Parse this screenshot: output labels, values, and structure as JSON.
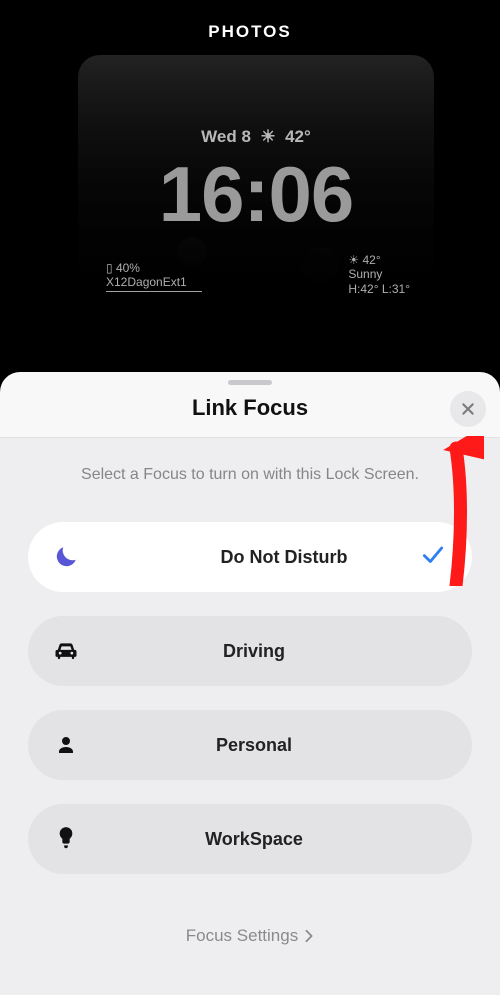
{
  "gallery": {
    "title": "PHOTOS"
  },
  "lockscreen": {
    "date": "Wed 8",
    "weather_glyph": "☀︎",
    "temp": "42°",
    "time": "16:06",
    "battery_pct": "40%",
    "wifi_name": "X12DagonExt1",
    "weather": {
      "temp": "42°",
      "condition": "Sunny",
      "hi_lo": "H:42° L:31°"
    }
  },
  "sheet": {
    "title": "Link Focus",
    "subtitle": "Select a Focus to turn on with this Lock Screen.",
    "settings_link": "Focus Settings",
    "focus_items": [
      {
        "label": "Do Not Disturb",
        "icon": "moon",
        "selected": true
      },
      {
        "label": "Driving",
        "icon": "car",
        "selected": false
      },
      {
        "label": "Personal",
        "icon": "person",
        "selected": false
      },
      {
        "label": "WorkSpace",
        "icon": "lightbulb",
        "selected": false
      }
    ]
  },
  "colors": {
    "accent": "#5856d6",
    "check": "#2f7ef6",
    "arrow": "#ff1a1a"
  }
}
